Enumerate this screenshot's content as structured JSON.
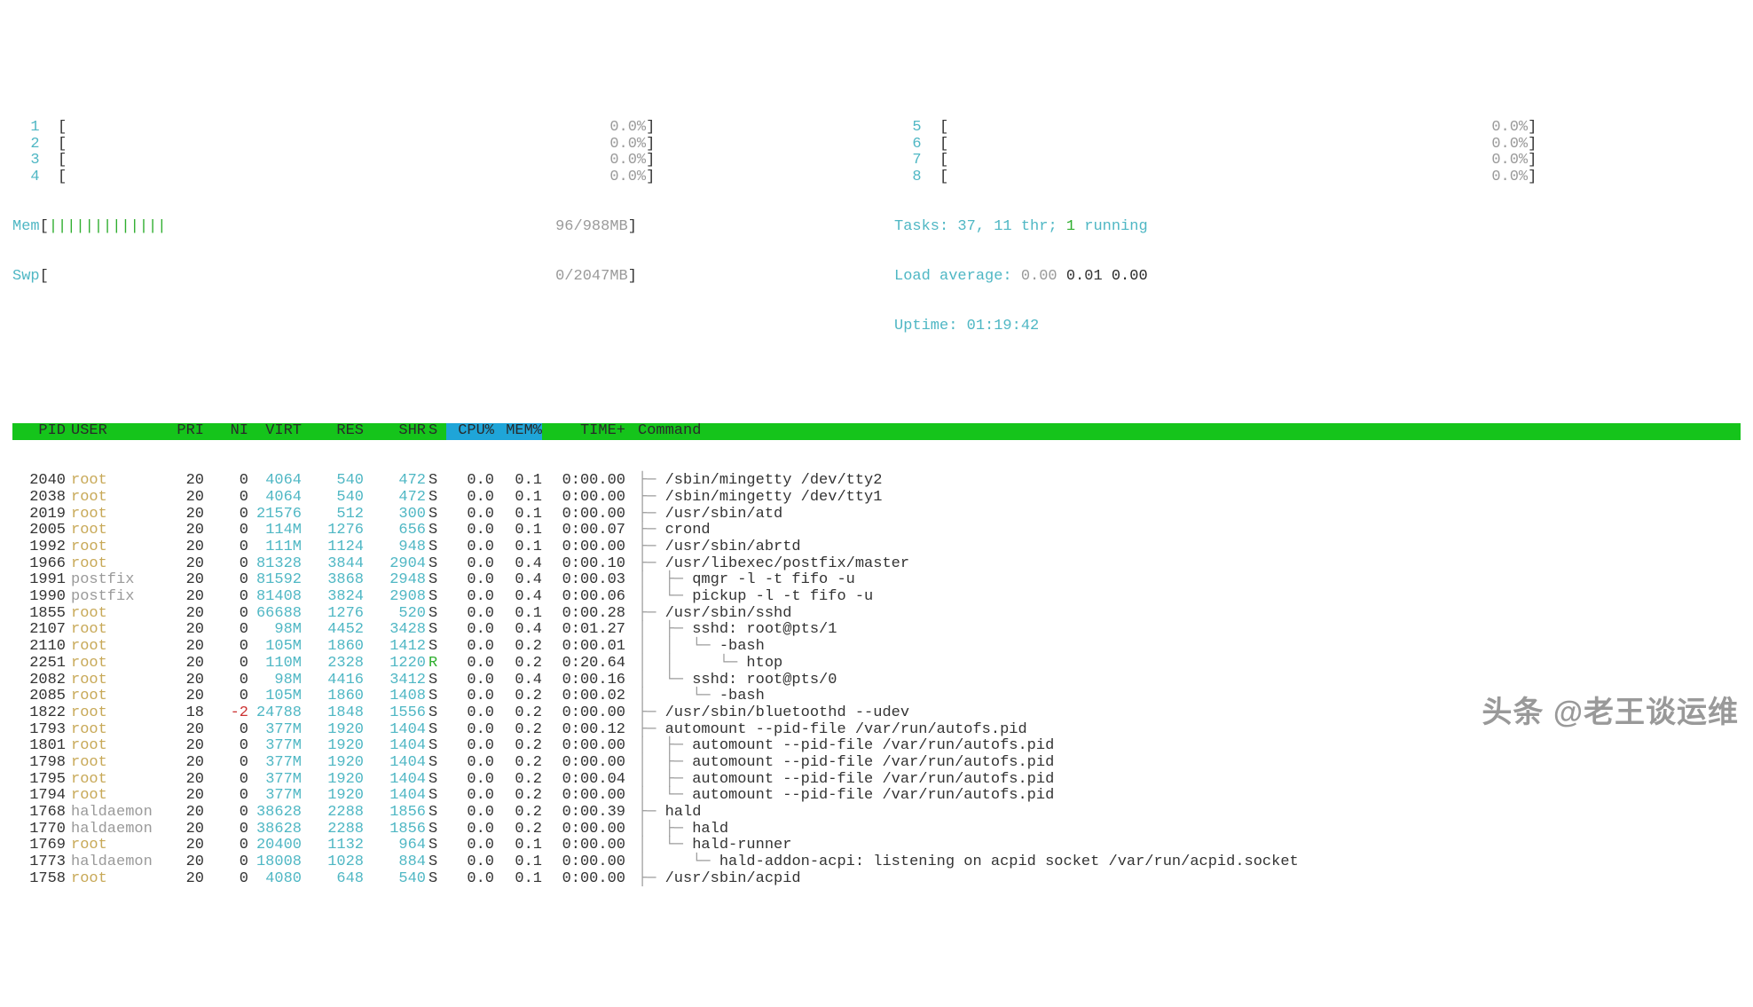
{
  "meters": {
    "cpus_left": [
      {
        "id": "1",
        "pct": "0.0%"
      },
      {
        "id": "2",
        "pct": "0.0%"
      },
      {
        "id": "3",
        "pct": "0.0%"
      },
      {
        "id": "4",
        "pct": "0.0%"
      }
    ],
    "cpus_right": [
      {
        "id": "5",
        "pct": "0.0%"
      },
      {
        "id": "6",
        "pct": "0.0%"
      },
      {
        "id": "7",
        "pct": "0.0%"
      },
      {
        "id": "8",
        "pct": "0.0%"
      }
    ],
    "mem_label": "Mem",
    "mem_bar": "|||||||||||||",
    "mem_value": "96/988MB",
    "swp_label": "Swp",
    "swp_value": "0/2047MB",
    "tasks_label": "Tasks:",
    "tasks_val": "37,",
    "thr_val": "11 thr;",
    "running": "1",
    "running_label": "running",
    "load_label": "Load average:",
    "load1": "0.00",
    "load2": "0.01",
    "load3": "0.00",
    "uptime_label": "Uptime:",
    "uptime": "01:19:42"
  },
  "columns": {
    "PID": "PID",
    "USER": "USER",
    "PRI": "PRI",
    "NI": "NI",
    "VIRT": "VIRT",
    "RES": "RES",
    "SHR": "SHR",
    "S": "S",
    "CPU": "CPU%",
    "MEM": "MEM%",
    "TIME": "TIME+",
    "CMD": "Command"
  },
  "rows": [
    {
      "pid": "2040",
      "user": "root",
      "pri": "20",
      "ni": "0",
      "virt": "4064",
      "res": "540",
      "shr": "472",
      "s": "S",
      "cpu": "0.0",
      "mem": "0.1",
      "time": "0:00.00",
      "tree": "├─ ",
      "cmd": "/sbin/mingetty /dev/tty2"
    },
    {
      "pid": "2038",
      "user": "root",
      "pri": "20",
      "ni": "0",
      "virt": "4064",
      "res": "540",
      "shr": "472",
      "s": "S",
      "cpu": "0.0",
      "mem": "0.1",
      "time": "0:00.00",
      "tree": "├─ ",
      "cmd": "/sbin/mingetty /dev/tty1"
    },
    {
      "pid": "2019",
      "user": "root",
      "pri": "20",
      "ni": "0",
      "virt": "21576",
      "res": "512",
      "shr": "300",
      "s": "S",
      "cpu": "0.0",
      "mem": "0.1",
      "time": "0:00.00",
      "tree": "├─ ",
      "cmd": "/usr/sbin/atd"
    },
    {
      "pid": "2005",
      "user": "root",
      "pri": "20",
      "ni": "0",
      "virt": "114M",
      "res": "1276",
      "shr": "656",
      "s": "S",
      "cpu": "0.0",
      "mem": "0.1",
      "time": "0:00.07",
      "tree": "├─ ",
      "cmd": "crond"
    },
    {
      "pid": "1992",
      "user": "root",
      "pri": "20",
      "ni": "0",
      "virt": "111M",
      "res": "1124",
      "shr": "948",
      "s": "S",
      "cpu": "0.0",
      "mem": "0.1",
      "time": "0:00.00",
      "tree": "├─ ",
      "cmd": "/usr/sbin/abrtd"
    },
    {
      "pid": "1966",
      "user": "root",
      "pri": "20",
      "ni": "0",
      "virt": "81328",
      "res": "3844",
      "shr": "2904",
      "s": "S",
      "cpu": "0.0",
      "mem": "0.4",
      "time": "0:00.10",
      "tree": "├─ ",
      "cmd": "/usr/libexec/postfix/master"
    },
    {
      "pid": "1991",
      "user": "postfix",
      "usercls": "grey",
      "pri": "20",
      "ni": "0",
      "virt": "81592",
      "res": "3868",
      "shr": "2948",
      "s": "S",
      "cpu": "0.0",
      "mem": "0.4",
      "time": "0:00.03",
      "tree": "│  ├─ ",
      "cmd": "qmgr -l -t fifo -u"
    },
    {
      "pid": "1990",
      "user": "postfix",
      "usercls": "grey",
      "pri": "20",
      "ni": "0",
      "virt": "81408",
      "res": "3824",
      "shr": "2908",
      "s": "S",
      "cpu": "0.0",
      "mem": "0.4",
      "time": "0:00.06",
      "tree": "│  └─ ",
      "cmd": "pickup -l -t fifo -u"
    },
    {
      "pid": "1855",
      "user": "root",
      "pri": "20",
      "ni": "0",
      "virt": "66688",
      "res": "1276",
      "shr": "520",
      "s": "S",
      "cpu": "0.0",
      "mem": "0.1",
      "time": "0:00.28",
      "tree": "├─ ",
      "cmd": "/usr/sbin/sshd"
    },
    {
      "pid": "2107",
      "user": "root",
      "pri": "20",
      "ni": "0",
      "virt": "98M",
      "res": "4452",
      "shr": "3428",
      "s": "S",
      "cpu": "0.0",
      "mem": "0.4",
      "time": "0:01.27",
      "tree": "│  ├─ ",
      "cmd": "sshd: root@pts/1"
    },
    {
      "pid": "2110",
      "user": "root",
      "pri": "20",
      "ni": "0",
      "virt": "105M",
      "res": "1860",
      "shr": "1412",
      "s": "S",
      "cpu": "0.0",
      "mem": "0.2",
      "time": "0:00.01",
      "tree": "│  │  └─ ",
      "cmd": "-bash"
    },
    {
      "pid": "2251",
      "user": "root",
      "pri": "20",
      "ni": "0",
      "virt": "110M",
      "res": "2328",
      "shr": "1220",
      "s": "R",
      "scls": "green",
      "cpu": "0.0",
      "mem": "0.2",
      "time": "0:20.64",
      "tree": "│  │     └─ ",
      "cmd": "htop"
    },
    {
      "pid": "2082",
      "user": "root",
      "pri": "20",
      "ni": "0",
      "virt": "98M",
      "res": "4416",
      "shr": "3412",
      "s": "S",
      "cpu": "0.0",
      "mem": "0.4",
      "time": "0:00.16",
      "tree": "│  └─ ",
      "cmd": "sshd: root@pts/0"
    },
    {
      "pid": "2085",
      "user": "root",
      "pri": "20",
      "ni": "0",
      "virt": "105M",
      "res": "1860",
      "shr": "1408",
      "s": "S",
      "cpu": "0.0",
      "mem": "0.2",
      "time": "0:00.02",
      "tree": "│     └─ ",
      "cmd": "-bash"
    },
    {
      "pid": "1822",
      "user": "root",
      "pri": "18",
      "ni": "-2",
      "nicls": "red",
      "virt": "24788",
      "res": "1848",
      "shr": "1556",
      "s": "S",
      "cpu": "0.0",
      "mem": "0.2",
      "time": "0:00.00",
      "tree": "├─ ",
      "cmd": "/usr/sbin/bluetoothd --udev"
    },
    {
      "pid": "1793",
      "user": "root",
      "pri": "20",
      "ni": "0",
      "virt": "377M",
      "res": "1920",
      "shr": "1404",
      "s": "S",
      "cpu": "0.0",
      "mem": "0.2",
      "time": "0:00.12",
      "tree": "├─ ",
      "cmd": "automount --pid-file /var/run/autofs.pid"
    },
    {
      "pid": "1801",
      "user": "root",
      "pri": "20",
      "ni": "0",
      "virt": "377M",
      "res": "1920",
      "shr": "1404",
      "s": "S",
      "cpu": "0.0",
      "mem": "0.2",
      "time": "0:00.00",
      "tree": "│  ├─ ",
      "cmd": "automount --pid-file /var/run/autofs.pid"
    },
    {
      "pid": "1798",
      "user": "root",
      "pri": "20",
      "ni": "0",
      "virt": "377M",
      "res": "1920",
      "shr": "1404",
      "s": "S",
      "cpu": "0.0",
      "mem": "0.2",
      "time": "0:00.00",
      "tree": "│  ├─ ",
      "cmd": "automount --pid-file /var/run/autofs.pid"
    },
    {
      "pid": "1795",
      "user": "root",
      "pri": "20",
      "ni": "0",
      "virt": "377M",
      "res": "1920",
      "shr": "1404",
      "s": "S",
      "cpu": "0.0",
      "mem": "0.2",
      "time": "0:00.04",
      "tree": "│  ├─ ",
      "cmd": "automount --pid-file /var/run/autofs.pid"
    },
    {
      "pid": "1794",
      "user": "root",
      "pri": "20",
      "ni": "0",
      "virt": "377M",
      "res": "1920",
      "shr": "1404",
      "s": "S",
      "cpu": "0.0",
      "mem": "0.2",
      "time": "0:00.00",
      "tree": "│  └─ ",
      "cmd": "automount --pid-file /var/run/autofs.pid"
    },
    {
      "pid": "1768",
      "user": "haldaemon",
      "usercls": "grey",
      "pri": "20",
      "ni": "0",
      "virt": "38628",
      "res": "2288",
      "shr": "1856",
      "s": "S",
      "cpu": "0.0",
      "mem": "0.2",
      "time": "0:00.39",
      "tree": "├─ ",
      "cmd": "hald"
    },
    {
      "pid": "1770",
      "user": "haldaemon",
      "usercls": "grey",
      "pri": "20",
      "ni": "0",
      "virt": "38628",
      "res": "2288",
      "shr": "1856",
      "s": "S",
      "cpu": "0.0",
      "mem": "0.2",
      "time": "0:00.00",
      "tree": "│  ├─ ",
      "cmd": "hald"
    },
    {
      "pid": "1769",
      "user": "root",
      "pri": "20",
      "ni": "0",
      "virt": "20400",
      "res": "1132",
      "shr": "964",
      "s": "S",
      "cpu": "0.0",
      "mem": "0.1",
      "time": "0:00.00",
      "tree": "│  └─ ",
      "cmd": "hald-runner"
    },
    {
      "pid": "1773",
      "user": "haldaemon",
      "usercls": "grey",
      "pri": "20",
      "ni": "0",
      "virt": "18008",
      "res": "1028",
      "shr": "884",
      "s": "S",
      "cpu": "0.0",
      "mem": "0.1",
      "time": "0:00.00",
      "tree": "│     └─ ",
      "cmd": "hald-addon-acpi: listening on acpid socket /var/run/acpid.socket"
    },
    {
      "pid": "1758",
      "user": "root",
      "pri": "20",
      "ni": "0",
      "virt": "4080",
      "res": "648",
      "shr": "540",
      "s": "S",
      "cpu": "0.0",
      "mem": "0.1",
      "time": "0:00.00",
      "tree": "├─ ",
      "cmd": "/usr/sbin/acpid"
    }
  ],
  "watermark": "头条 @老王谈运维"
}
